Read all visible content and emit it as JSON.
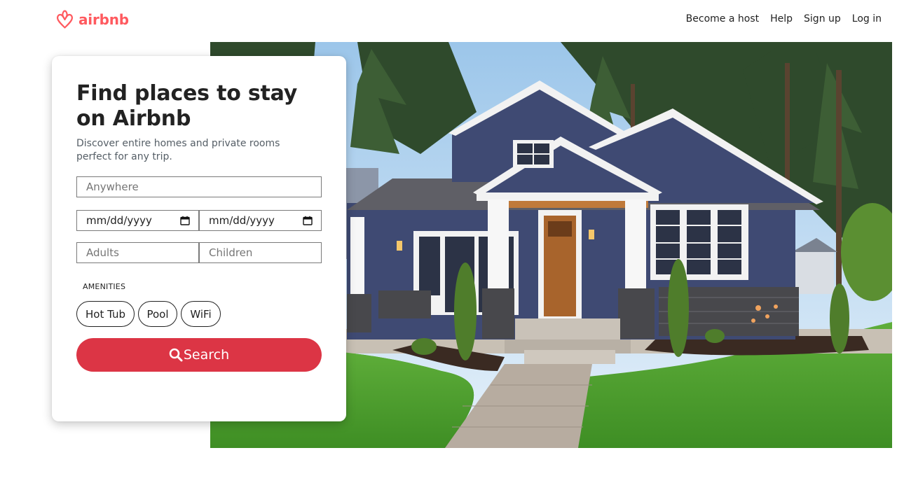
{
  "brand": {
    "name": "airbnb",
    "color": "#ff5a5f"
  },
  "nav": {
    "items": [
      "Become a host",
      "Help",
      "Sign up",
      "Log in"
    ]
  },
  "card": {
    "title": "Find places to stay on Airbnb",
    "subtitle": "Discover entire homes and private rooms perfect for any trip.",
    "location": {
      "placeholder": "Anywhere",
      "value": ""
    },
    "checkin": {
      "display": "mm/dd/yyyy",
      "icon": "calendar-icon"
    },
    "checkout": {
      "display": "mm/dd/yyyy",
      "icon": "calendar-icon"
    },
    "adults": {
      "placeholder": "Adults",
      "value": ""
    },
    "children": {
      "placeholder": "Children",
      "value": ""
    },
    "amenities_label": "AMENITIES",
    "amenities": [
      "Hot Tub",
      "Pool",
      "WiFi"
    ],
    "search_label": "Search",
    "search_icon": "search-icon",
    "search_color": "#dc3545"
  },
  "hero": {
    "image": "house-photo",
    "description_icon": "house-illustration"
  }
}
